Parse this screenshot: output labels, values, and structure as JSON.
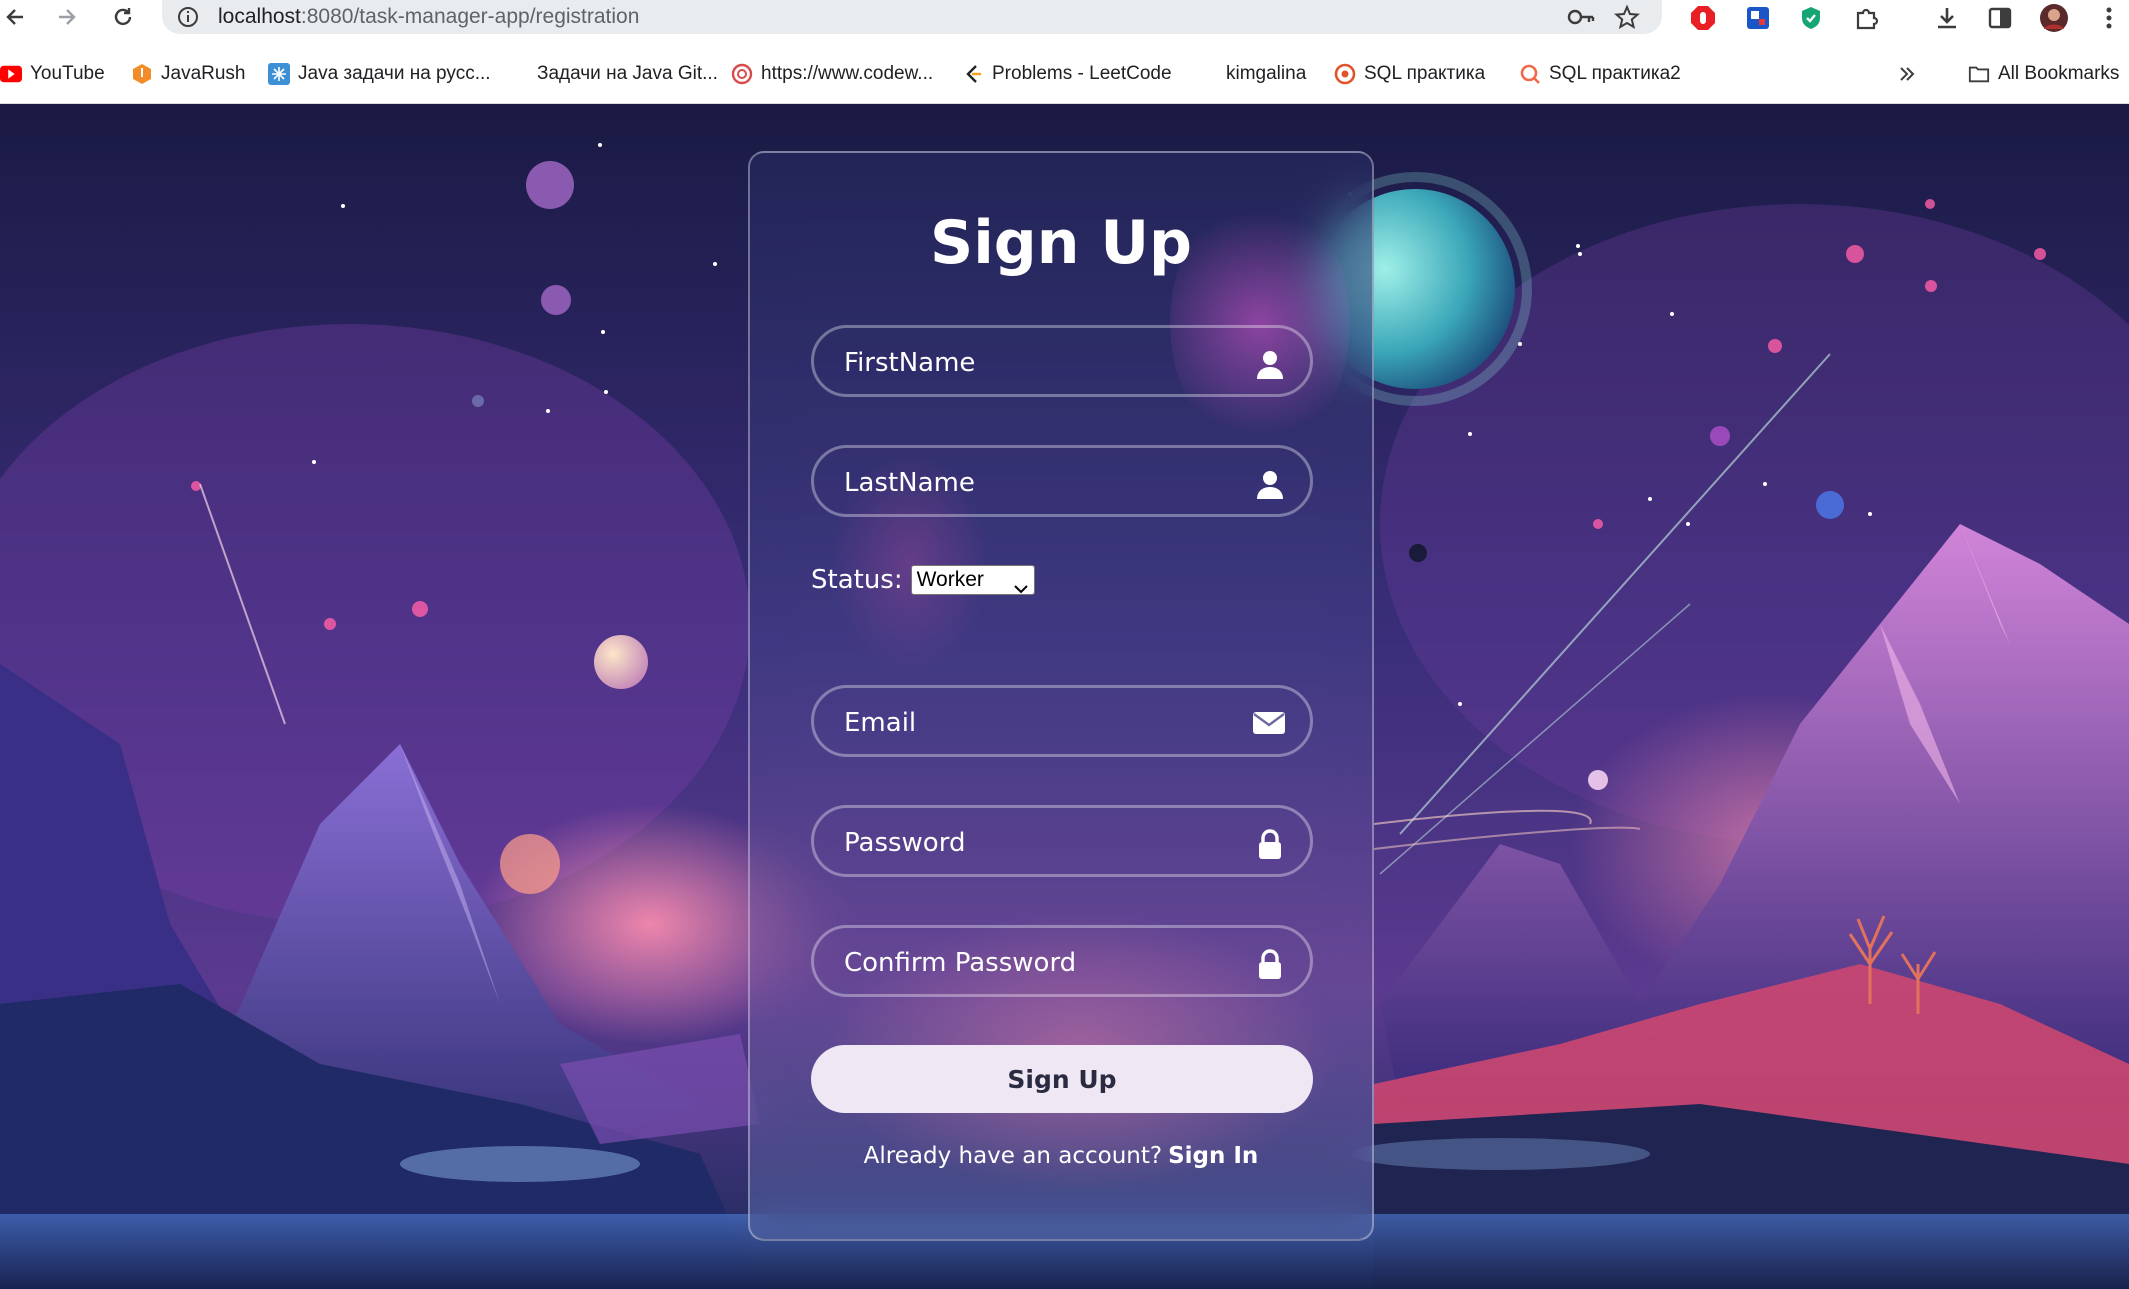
{
  "browser": {
    "url_host": "localhost",
    "url_path": ":8080/task-manager-app/registration"
  },
  "bookmarks": [
    {
      "label": "YouTube",
      "icon": "youtube-icon"
    },
    {
      "label": "JavaRush",
      "icon": "javarush-icon"
    },
    {
      "label": "Java задачи на русс...",
      "icon": "java-tasks-icon"
    },
    {
      "label": "Задачи на Java Git...",
      "icon": ""
    },
    {
      "label": "https://www.codew...",
      "icon": "codewars-icon"
    },
    {
      "label": "Problems - LeetCode",
      "icon": "leetcode-icon"
    },
    {
      "label": "kimgalina",
      "icon": ""
    },
    {
      "label": "SQL  практика",
      "icon": "sql-icon"
    },
    {
      "label": "SQL практика2",
      "icon": "sql2-icon"
    }
  ],
  "all_bookmarks_label": "All Bookmarks",
  "form": {
    "title": "Sign Up",
    "first_name_placeholder": "FirstName",
    "last_name_placeholder": "LastName",
    "status_label": "Status:",
    "status_value": "Worker",
    "email_placeholder": "Email",
    "password_placeholder": "Password",
    "confirm_password_placeholder": "Confirm Password",
    "submit_label": "Sign Up",
    "footer_prompt": "Already have an account?",
    "footer_link": "Sign In"
  },
  "colors": {
    "card_text": "#ffffff",
    "button_bg": "#efe8f4",
    "scene_sky": "#1b1a45"
  }
}
